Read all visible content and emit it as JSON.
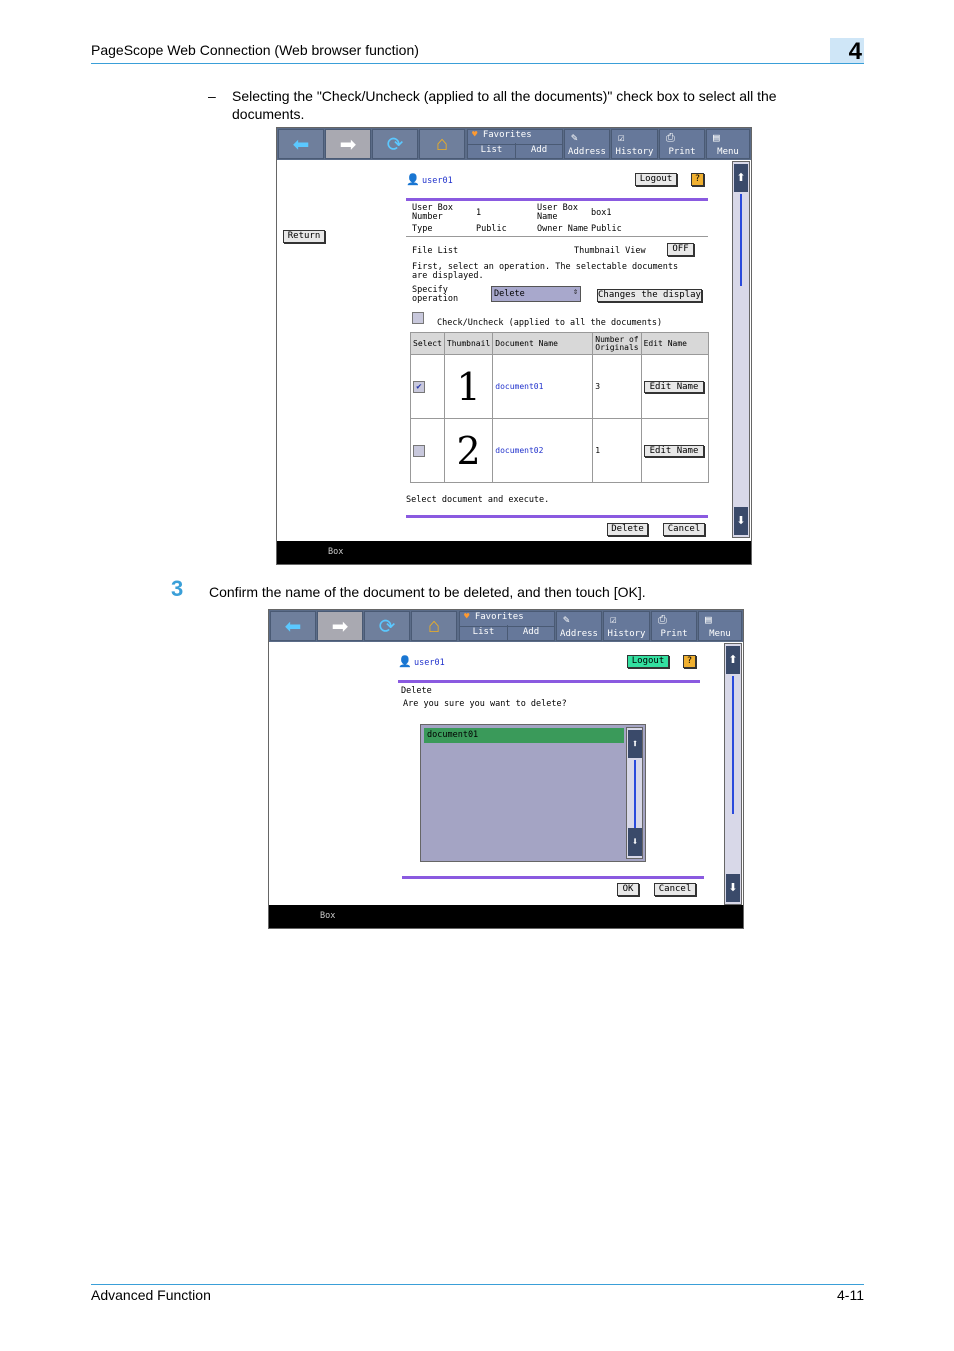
{
  "header": {
    "title": "PageScope Web Connection (Web browser function)",
    "chapter": "4"
  },
  "footer": {
    "left": "Advanced Function",
    "right": "4-11"
  },
  "bullet": {
    "dash": "–",
    "text1": "Selecting the \"Check/Uncheck (applied to all the documents)\" check box to select all the",
    "text2": "documents."
  },
  "step3": {
    "num": "3",
    "text": "Confirm the name of the document to be deleted, and then touch [OK]."
  },
  "toolbar": {
    "favorites": "Favorites",
    "list": "List",
    "add": "Add",
    "address": "Address",
    "history": "History",
    "print": "Print",
    "menu": "Menu"
  },
  "shot1": {
    "user": "user01",
    "logout": "Logout",
    "help": "?",
    "return": "Return",
    "box_info": {
      "number_label": "User Box Number",
      "number_value": "1",
      "name_label": "User Box Name",
      "name_value": "box1",
      "type_label": "Type",
      "type_value": "Public",
      "owner_label": "Owner Name",
      "owner_value": "Public"
    },
    "file_list": "File List",
    "thumb_label": "Thumbnail View",
    "thumb_value": "OFF",
    "instruction": "First, select an operation. The selectable documents are displayed.",
    "specify_label": "Specify operation",
    "operation": "Delete",
    "changes_display": "Changes the display",
    "check_all": "Check/Uncheck (applied to all the documents)",
    "columns": [
      "Select",
      "Thumbnail",
      "Document Name",
      "Number of Originals",
      "Edit Name"
    ],
    "rows": [
      {
        "thumb": "1",
        "name": "document01",
        "originals": "3",
        "edit": "Edit Name",
        "checked": true
      },
      {
        "thumb": "2",
        "name": "document02",
        "originals": "1",
        "edit": "Edit Name",
        "checked": false
      }
    ],
    "select_execute": "Select document and execute.",
    "delete": "Delete",
    "cancel": "Cancel",
    "status": "Box"
  },
  "shot2": {
    "user": "user01",
    "logout": "Logout",
    "help": "?",
    "delete_title": "Delete",
    "confirm": "Are you sure you want to delete?",
    "selected_doc": "document01",
    "ok": "OK",
    "cancel": "Cancel",
    "status": "Box"
  },
  "colors": {
    "accent": "#3a9fd8",
    "purple": "#8a5ae0",
    "toolbar": "#5b6c88",
    "logout_active": "#33e0a0",
    "list_selected": "#3a9a5a",
    "list_bg": "#a4a4c4"
  }
}
